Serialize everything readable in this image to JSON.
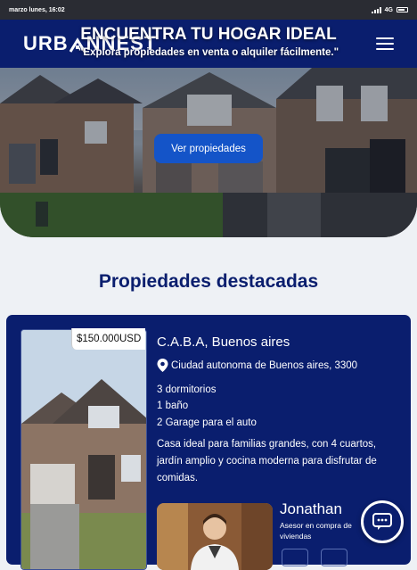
{
  "status_bar": {
    "datetime": "marzo lunes, 16:02",
    "network": "4G"
  },
  "header": {
    "logo_left": "URB",
    "logo_right": "NNEST",
    "menu_icon": "hamburger-menu-icon"
  },
  "hero": {
    "title": "ENCUENTRA TU HOGAR IDEAL",
    "subtitle": "\"Explora propiedades en venta o alquiler fácilmente.\"",
    "button_label": "Ver propiedades"
  },
  "featured": {
    "title": "Propiedades destacadas"
  },
  "property": {
    "price": "$150.000USD",
    "location": "C.A.B.A, Buenos aires",
    "address": "Ciudad autonoma de Buenos aires, 3300",
    "features": [
      "3 dormitorios",
      "1 baño",
      "2 Garage para el auto"
    ],
    "description": "Casa ideal para familias grandes, con 4 cuartos, jardín amplio y cocina moderna para disfrutar de comidas.",
    "agent": {
      "name": "Jonathan",
      "role": "Asesor en compra de viviendas"
    }
  },
  "colors": {
    "brand_navy": "#0a1e6e",
    "button_blue": "#1454c8",
    "page_bg": "#eef1f5"
  },
  "chat_button_icon": "chat-bubble-icon"
}
